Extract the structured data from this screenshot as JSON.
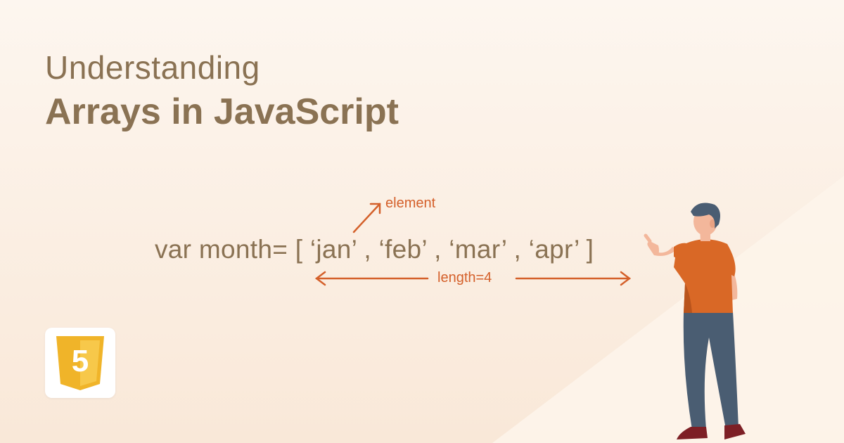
{
  "title": {
    "line1": "Understanding",
    "line2": "Arrays in JavaScript"
  },
  "code": {
    "text": "var month= [ ‘jan’ , ‘feb’ , ‘mar’ , ‘apr’ ]"
  },
  "annotations": {
    "element": "element",
    "length": "length=4"
  },
  "logo": {
    "glyph": "5"
  },
  "colors": {
    "title": "#8a7253",
    "accent": "#d4602a",
    "logo_shield": "#f0b429",
    "shirt": "#d96826",
    "pants": "#4a5d72"
  }
}
